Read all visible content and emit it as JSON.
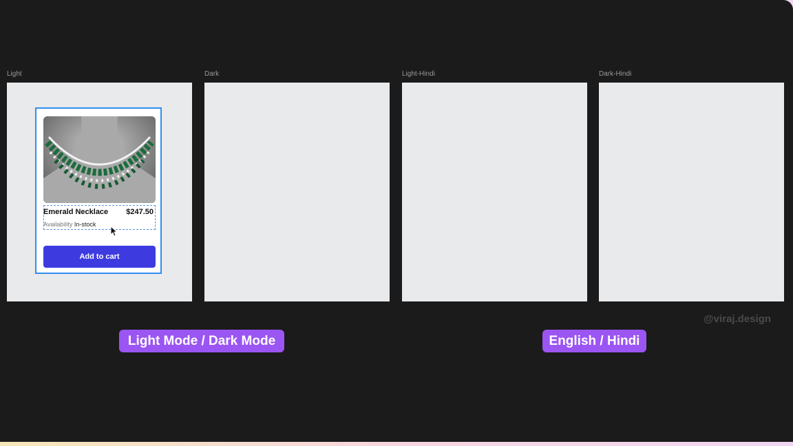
{
  "frames": [
    {
      "label": "Light"
    },
    {
      "label": "Dark"
    },
    {
      "label": "Light-Hindi"
    },
    {
      "label": "Dark-Hindi"
    }
  ],
  "product": {
    "name": "Emerald Necklace",
    "price": "$247.50",
    "availability_label": "Availability",
    "availability_value": "In-stock",
    "cart_label": "Add to cart",
    "image_icon": "necklace-image"
  },
  "watermark": "@viraj.design",
  "pills": {
    "left": "Light Mode / Dark Mode",
    "right": "English / Hindi"
  },
  "colors": {
    "canvas": "#1b1b1b",
    "frame": "#e8eaec",
    "selection": "#2f8df2",
    "button": "#3d3be0",
    "pill": "#9b55f2"
  }
}
